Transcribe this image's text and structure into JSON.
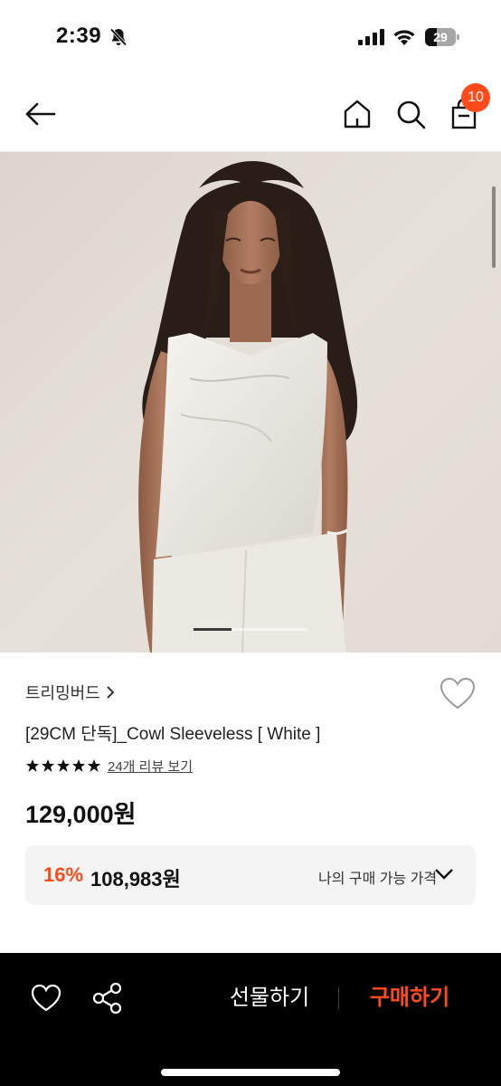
{
  "status_bar": {
    "time": "2:39",
    "battery_level": "29",
    "icons": [
      "bell-slash-icon",
      "signal-icon",
      "wifi-icon",
      "battery-icon"
    ]
  },
  "nav": {
    "icons": [
      "arrow-left-icon",
      "home-icon",
      "search-icon",
      "shopping-bag-icon"
    ],
    "cart_count": "10"
  },
  "hero": {
    "image": "model-in-white-cowl-sleeveless-top-photo",
    "slide_index": 1,
    "slide_count": 3
  },
  "product": {
    "brand": "트리밍버드",
    "title": "[29CM 단독]_Cowl Sleeveless [ White ]",
    "rating_stars": 5,
    "review_link": "24개 리뷰 보기",
    "price": "129,000원"
  },
  "discount": {
    "rate": "16%",
    "price": "108,983원",
    "label": "나의 구매 가능 가격"
  },
  "bottom_bar": {
    "gift_label": "선물하기",
    "buy_label": "구매하기",
    "icons": [
      "heart-icon",
      "share-icon"
    ]
  },
  "colors": {
    "accent": "#ff4a1c",
    "bottom_bar_bg": "#000000",
    "price_box_bg": "#f4f4f4"
  }
}
